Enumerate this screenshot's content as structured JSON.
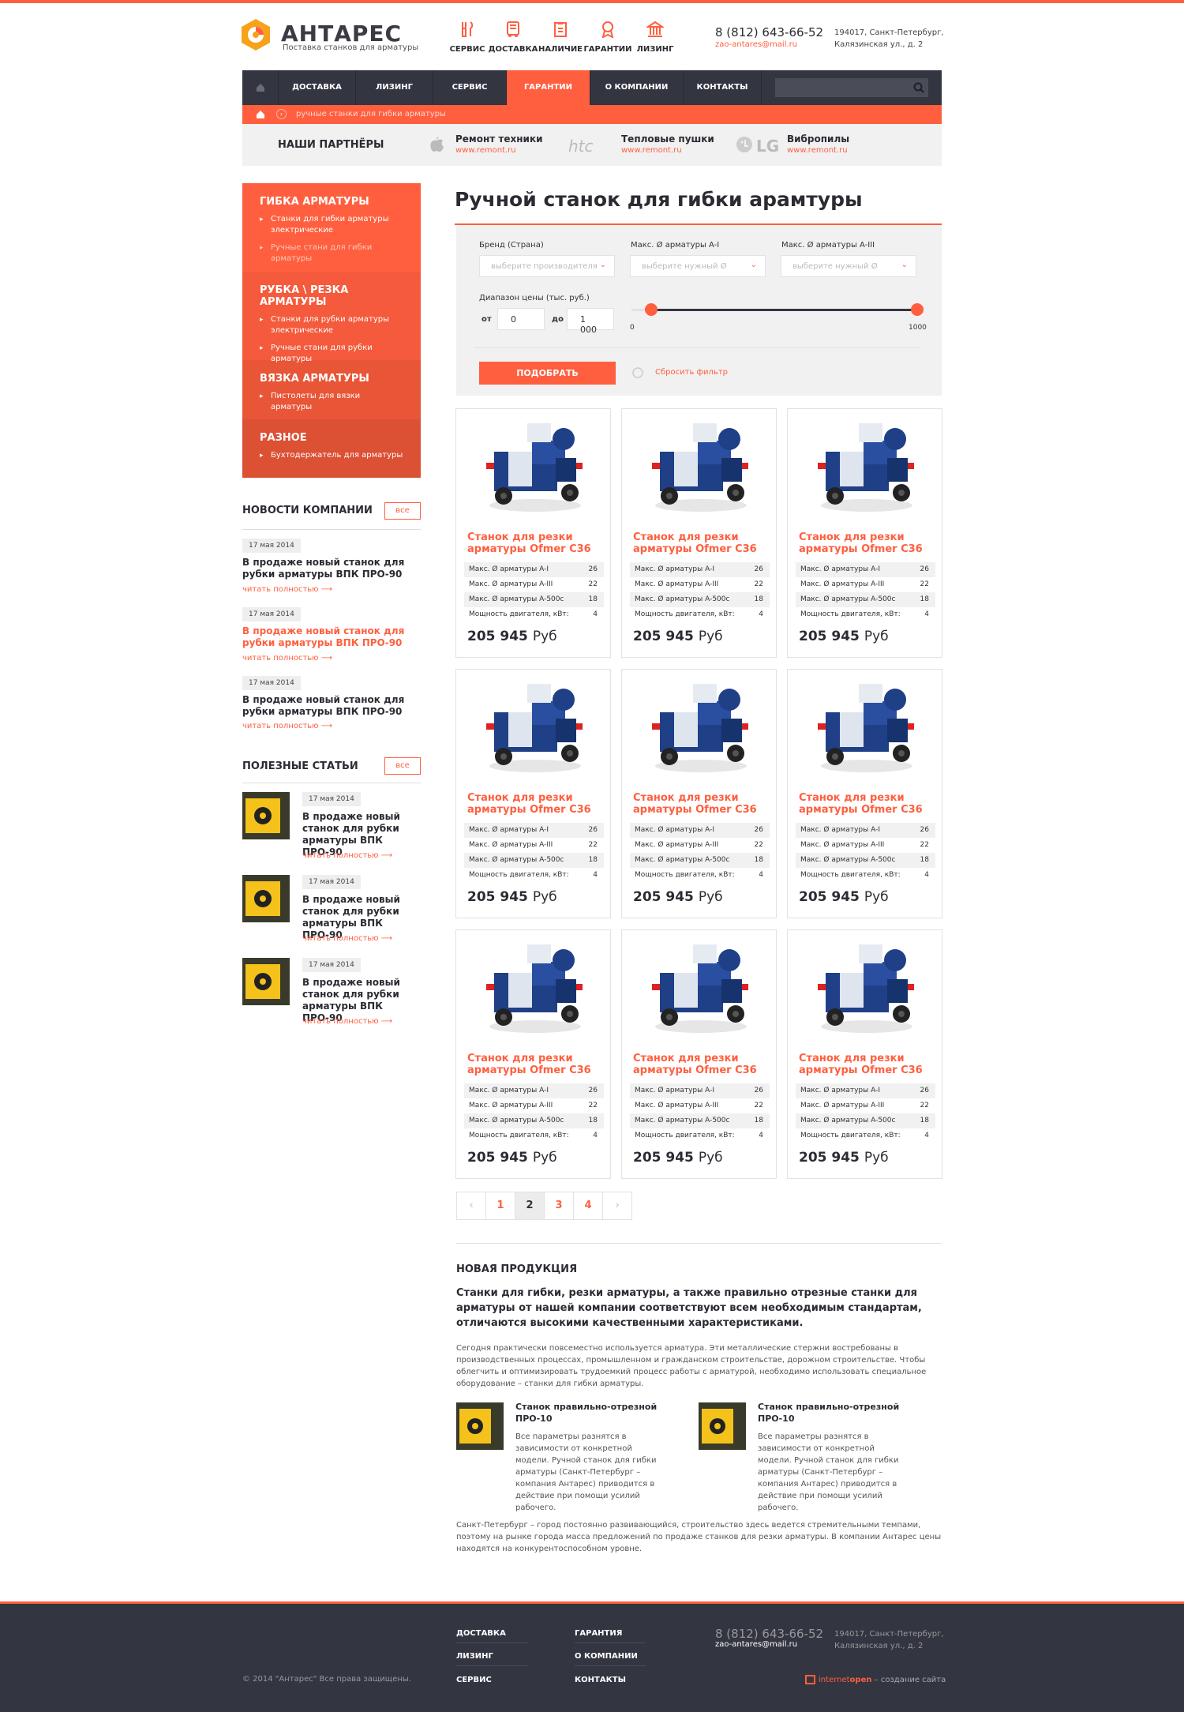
{
  "brand": {
    "name": "АНТАРЕС",
    "tagline": "Поставка станков для арматуры"
  },
  "services": [
    {
      "label": "СЕРВИС",
      "icon": "tools-icon"
    },
    {
      "label": "ДОСТАВКА",
      "icon": "truck-icon"
    },
    {
      "label": "НАЛИЧИЕ",
      "icon": "clipboard-icon"
    },
    {
      "label": "ГАРАНТИИ",
      "icon": "medal-icon"
    },
    {
      "label": "ЛИЗИНГ",
      "icon": "bank-icon"
    }
  ],
  "contacts": {
    "phone": "8 (812) 643-66-52",
    "email": "zao-antares@mail.ru",
    "address_line1": "194017, Санкт-Петербург,",
    "address_line2": "Калязинская ул., д. 2"
  },
  "nav": {
    "items": [
      "ДОСТАВКА",
      "ЛИЗИНГ",
      "СЕРВИС",
      "ГАРАНТИИ",
      "О КОМПАНИИ",
      "КОНТАКТЫ"
    ],
    "active": "ГАРАНТИИ"
  },
  "breadcrumb": {
    "current": "ручные станки для гибки арматуры"
  },
  "partners": {
    "title": "НАШИ ПАРТНЁРЫ",
    "items": [
      {
        "logo": "apple-logo",
        "name": "Ремонт техники",
        "url": "www.remont.ru"
      },
      {
        "logo_text": "htc",
        "name": "Тепловые пушки",
        "url": "www.remont.ru"
      },
      {
        "logo_text": "LG",
        "name": "Вибропилы",
        "url": "www.remont.ru"
      }
    ]
  },
  "categories": [
    {
      "title": "ГИБКА АРМАТУРЫ",
      "items": [
        "Станки для гибки арматуры электрические",
        "Ручные стани для гибки арматуры"
      ],
      "color": "#ff5f3f"
    },
    {
      "title": "РУБКА \\ РЕЗКА АРМАТУРЫ",
      "items": [
        "Станки для рубки арматуры электрические",
        "Ручные стани для рубки арматуры"
      ],
      "color": "#f45a3b"
    },
    {
      "title": "ВЯЗКА АРМАТУРЫ",
      "items": [
        "Пистолеты для вязки арматуры"
      ],
      "color": "#e85537"
    },
    {
      "title": "РАЗНОЕ",
      "items": [
        "Бухтодержатель для арматуры"
      ],
      "color": "#dc5034"
    }
  ],
  "news": {
    "title": "НОВОСТИ КОМПАНИИ",
    "all": "все",
    "items": [
      {
        "date": "17 мая 2014",
        "title": "В продаже новый станок для рубки арматуры ВПК ПРО-90",
        "more": "читать полностью"
      },
      {
        "date": "17 мая 2014",
        "title": "В продаже новый станок для рубки арматуры ВПК ПРО-90",
        "more": "читать полностью"
      },
      {
        "date": "17 мая 2014",
        "title": "В продаже новый станок для рубки арматуры ВПК ПРО-90",
        "more": "читать полностью"
      }
    ]
  },
  "articles": {
    "title": "ПОЛЕЗНЫЕ СТАТЬИ",
    "all": "все",
    "items": [
      {
        "date": "17 мая 2014",
        "title": "В продаже новый станок для рубки арматуры ВПК ПРО-90",
        "more": "читать полностью"
      },
      {
        "date": "17 мая 2014",
        "title": "В продаже новый станок для рубки арматуры ВПК ПРО-90",
        "more": "читать полностью"
      },
      {
        "date": "17 мая 2014",
        "title": "В продаже новый станок для рубки арматуры ВПК ПРО-90",
        "more": "читать полностью"
      }
    ]
  },
  "page_title": "Ручной станок для гибки арамтуры",
  "filter": {
    "brand_label": "Бренд (Страна)",
    "brand_placeholder": "выберите производителя",
    "a1_label": "Макс. Ø арматуры A-I",
    "a1_placeholder": "выберите нужный Ø",
    "a3_label": "Макс. Ø арматуры A-III",
    "a3_placeholder": "выберите нужный Ø",
    "price_label": "Диапазон цены (тыс. руб.)",
    "from_label": "от",
    "from_value": "0",
    "to_label": "до",
    "to_value": "1 000",
    "slider_min": "0",
    "slider_max": "1000",
    "range_low": 0.07,
    "range_high": 1.0,
    "submit": "ПОДОБРАТЬ",
    "reset": "Сбросить фильтр"
  },
  "product_template": {
    "name": "Станок для резки арматуры Ofmer C36",
    "specs": [
      {
        "label": "Макс. Ø арматуры A-I",
        "value": "26"
      },
      {
        "label": "Макс. Ø арматуры A-III",
        "value": "22"
      },
      {
        "label": "Макс. Ø арматуры A-500с",
        "value": "18"
      },
      {
        "label": "Мощность двигателя, кВт:",
        "value": "4"
      }
    ],
    "price": "205 945",
    "currency": "Руб"
  },
  "product_count": 9,
  "pagination": {
    "prev": "‹",
    "pages": [
      "1",
      "2",
      "3",
      "4"
    ],
    "active": "2",
    "next": "›"
  },
  "new_products": {
    "title": "НОВАЯ ПРОДУКЦИЯ",
    "lead": "Станки для гибки, резки арматуры, а также правильно отрезные станки для арматуры от нашей компании соответствуют всем необходимым стандартам, отличаются высокими качественными характеристиками.",
    "text": "Сегодня практически повсеместно используется арматура. Эти металлические стержни востребованы в производственных процессах, промышленном и гражданском строительстве, дорожном строительстве. Чтобы облегчить и оптимизировать трудоемкий процесс работы с арматурой, необходимо использовать специальное оборудование – станки для гибки арматуры.",
    "items": [
      {
        "title": "Станок правильно-отрезной ПРО-10",
        "text": "Все параметры разнятся в зависимости от конкретной модели. Ручной станок для гибки арматуры (Санкт-Петербург – компания Антарес) приводится в действие при помощи усилий рабочего."
      },
      {
        "title": "Станок правильно-отрезной ПРО-10",
        "text": "Все параметры разнятся в зависимости от конкретной модели. Ручной станок для гибки арматуры (Санкт-Петербург – компания Антарес) приводится в действие при помощи усилий рабочего."
      }
    ],
    "bottom": "Санкт-Петербург – город постоянно развивающийся, строительство здесь ведется стремительными темпами, поэтому на рынке города масса предложений по продаже станков для резки арматуры. В компании Антарес цены находятся на конкурентоспособном уровне."
  },
  "footer": {
    "col1": [
      "ДОСТАВКА",
      "ЛИЗИНГ",
      "СЕРВИС"
    ],
    "col2": [
      "ГАРАНТИЯ",
      "О КОМПАНИИ",
      "КОНТАКТЫ"
    ],
    "copyright": "© 2014 \"Антарес\" Все права защищены.",
    "credit_brand_a": "internet",
    "credit_brand_b": "open",
    "credit_suffix": " – создание сайта"
  },
  "colors": {
    "accent": "#ff5f3f",
    "dark": "#333541"
  }
}
